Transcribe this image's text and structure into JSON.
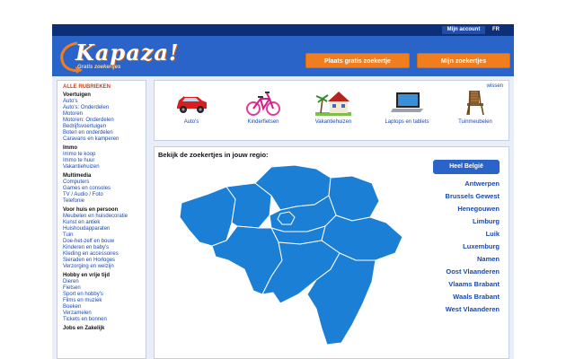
{
  "topbar": {
    "account_label": "Mijn account",
    "lang_label": "FR"
  },
  "header": {
    "logo_text": "Kapaza!",
    "logo_tagline": "Gratis zoekertjes",
    "place_button": "Plaats gratis zoekertje",
    "mine_button": "Mijn zoekertjes"
  },
  "sidebar": {
    "title": "ALLE RUBRIEKEN",
    "groups": [
      {
        "name": "Voertuigen",
        "items": [
          "Auto's",
          "Auto's: Onderdelen",
          "Motoren",
          "Motoren: Onderdelen",
          "Bedrijfsvoertuigen",
          "Boten en onderdelen",
          "Caravans en kamperen"
        ]
      },
      {
        "name": "Immo",
        "items": [
          "Immo te koop",
          "Immo te huur",
          "Vakantiehuizen"
        ]
      },
      {
        "name": "Multimedia",
        "items": [
          "Computers",
          "Games en consoles",
          "TV / Audio / Foto",
          "Telefonie"
        ]
      },
      {
        "name": "Voor huis en persoon",
        "items": [
          "Meubelen en huisdecoratie",
          "Kunst en antiek",
          "Huishoudapparaten",
          "Tuin",
          "Doe-het-zelf en bouw",
          "Kinderen en baby's",
          "Kleding en accessoires",
          "Sieraden en Horloges",
          "Verzorging en welzijn"
        ]
      },
      {
        "name": "Hobby en vrije tijd",
        "items": [
          "Dieren",
          "Fietsen",
          "Sport en hobby's",
          "Films en muziek",
          "Boeken",
          "Verzamelen",
          "Tickets en bonnen"
        ]
      },
      {
        "name": "Jobs en Zakelijk",
        "items": []
      }
    ]
  },
  "categories": {
    "items": [
      {
        "label": "Auto's",
        "icon": "car-icon"
      },
      {
        "label": "Kinderfietsen",
        "icon": "kids-bike-icon"
      },
      {
        "label": "Vakantiehuizen",
        "icon": "holiday-house-icon"
      },
      {
        "label": "Laptops en tablets",
        "icon": "laptop-icon"
      },
      {
        "label": "Tuinmeubelen",
        "icon": "garden-chair-icon"
      }
    ],
    "clear_label": "wissen"
  },
  "regions": {
    "title": "Bekijk de zoekertjes in jouw regio:",
    "all_label": "Heel België",
    "list": [
      "Antwerpen",
      "Brussels Gewest",
      "Henegouwen",
      "Limburg",
      "Luik",
      "Luxemburg",
      "Namen",
      "Oost Vlaanderen",
      "Vlaams Brabant",
      "Waals Brabant",
      "West Vlaanderen"
    ]
  },
  "colors": {
    "brand_blue": "#2a64c8",
    "dark_blue": "#0d2f78",
    "orange": "#f07d1e",
    "map_blue": "#1c7fd6",
    "link_blue": "#1a48b0"
  }
}
